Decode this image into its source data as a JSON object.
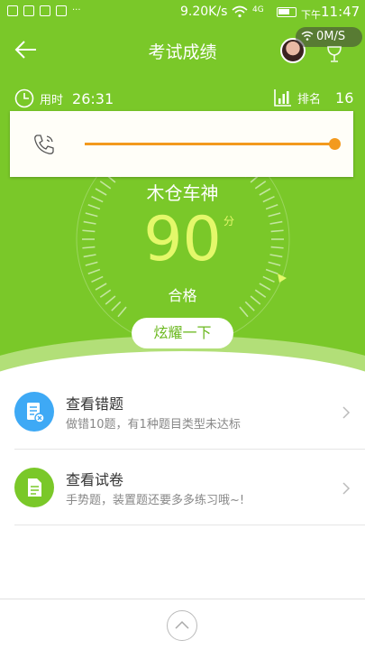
{
  "status_bar": {
    "speed": "9.20K/s",
    "network": "4G",
    "ampm": "下午",
    "time": "11:47"
  },
  "header": {
    "title": "考试成绩",
    "net_speed": "0M/S"
  },
  "stats": {
    "time_label": "用时",
    "time_value": "26:31",
    "rank_label": "排名",
    "rank_value": "16"
  },
  "result": {
    "grade": "木仓车神",
    "score": "90",
    "unit": "分",
    "status": "合格",
    "share_button": "炫耀一下"
  },
  "call_overlay": {
    "progress": 1.0
  },
  "list": [
    {
      "title": "查看错题",
      "subtitle": "做错10题，有1种题目类型未达标",
      "icon": "wrong-questions-icon",
      "color": "#3ea9f5"
    },
    {
      "title": "查看试卷",
      "subtitle": "手势题，装置题还要多多练习哦~!",
      "icon": "exam-paper-icon",
      "color": "#7ac829"
    }
  ],
  "colors": {
    "accent": "#7ac829",
    "score": "#e4f86a",
    "progress": "#f39a1e"
  }
}
